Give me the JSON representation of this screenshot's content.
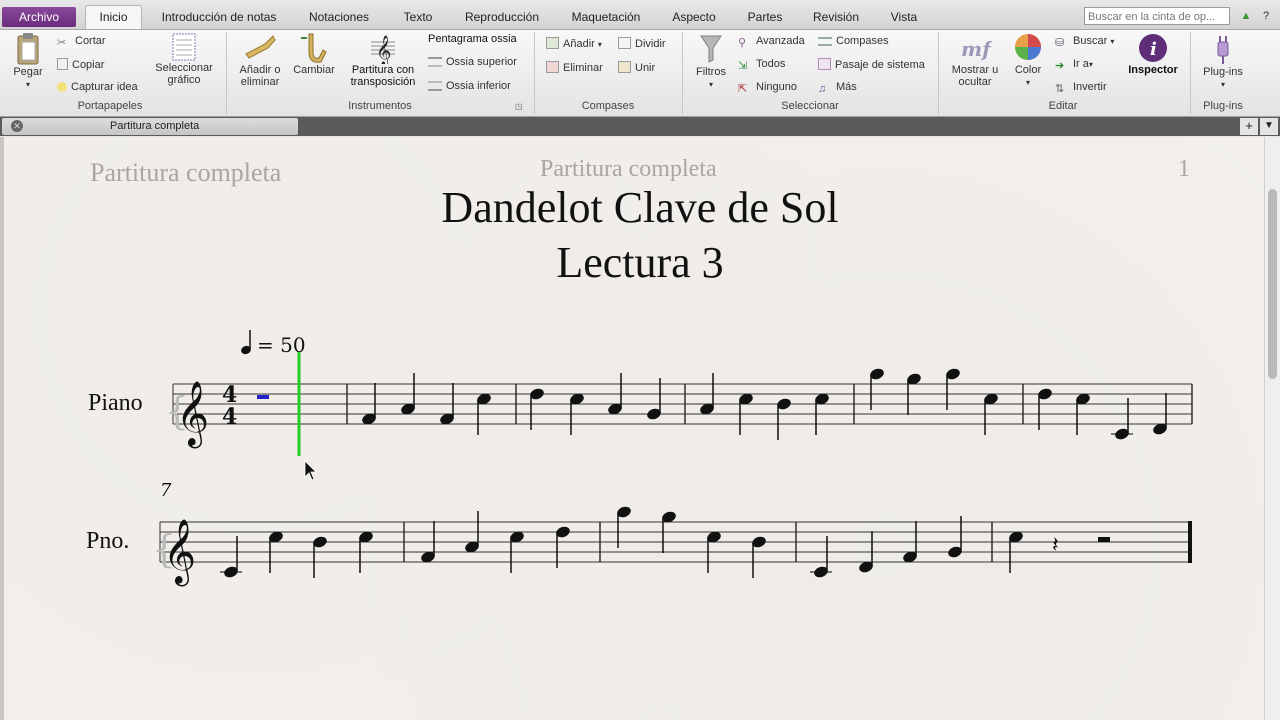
{
  "tabs": [
    "Archivo",
    "Introducción de notas",
    "Notaciones",
    "Texto",
    "Reproducción",
    "Maquetación",
    "Aspecto",
    "Partes",
    "Revisión",
    "Vista"
  ],
  "active_tab": "Inicio",
  "search_placeholder": "Buscar en la cinta de op...",
  "ribbon": {
    "portapapeles": {
      "pegar": "Pegar",
      "cortar": "Cortar",
      "copiar": "Copiar",
      "capturar": "Capturar idea",
      "seleccionar_grafico": "Seleccionar gráfico",
      "label": "Portapapeles"
    },
    "instrumentos": {
      "anadir": "Añadir o eliminar",
      "cambiar": "Cambiar",
      "partitura": "Partitura con transposición",
      "ossia_label": "Pentagrama ossia",
      "ossia_sup": "Ossia superior",
      "ossia_inf": "Ossia inferior",
      "label": "Instrumentos"
    },
    "compases": {
      "anadir": "Añadir",
      "eliminar": "Eliminar",
      "dividir": "Dividir",
      "unir": "Unir",
      "label": "Compases"
    },
    "seleccionar": {
      "filtros": "Filtros",
      "avanzada": "Avanzada",
      "todos": "Todos",
      "ninguno": "Ninguno",
      "compases": "Compases",
      "pasaje": "Pasaje de sistema",
      "mas": "Más",
      "label": "Seleccionar"
    },
    "editar": {
      "mostrar": "Mostrar u ocultar",
      "color": "Color",
      "buscar": "Buscar",
      "ir": "Ir a",
      "invertir": "Invertir",
      "inspector": "Inspector",
      "label": "Editar"
    },
    "plugins": {
      "btn": "Plug-ins",
      "label": "Plug-ins"
    }
  },
  "document_tab": "Partitura completa",
  "score": {
    "header_left": "Partitura completa",
    "header_center": "Partitura completa",
    "page_number": "1",
    "title": "Dandelot Clave de Sol",
    "subtitle": "Lectura 3",
    "tempo_value": "= 50",
    "instrument_full": "Piano",
    "instrument_short": "Pno.",
    "measure_number": "7",
    "time_signature_top": "4",
    "time_signature_bottom": "4"
  },
  "colors": {
    "file_tab": "#6a2c7c",
    "playback_line": "#22cc22",
    "selection": "#2222cc"
  }
}
